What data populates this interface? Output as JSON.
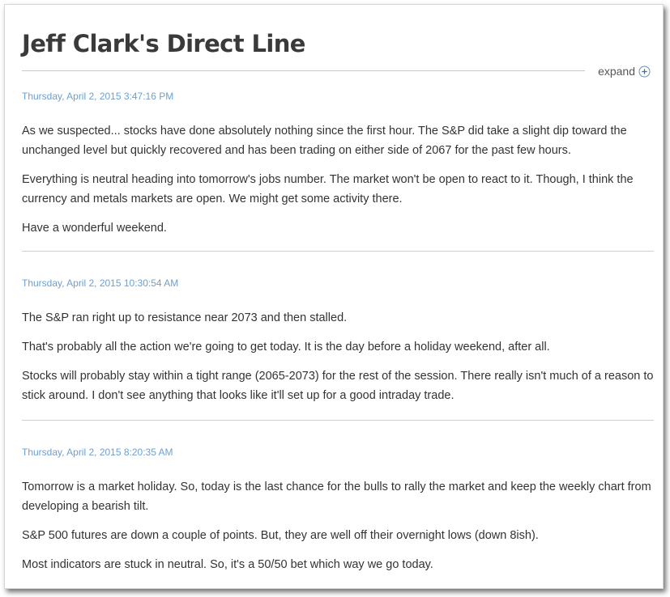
{
  "page": {
    "title": "Jeff Clark's Direct Line",
    "expand_label": "expand",
    "expand_icon": "plus-circle-icon",
    "accent_color": "#6ea0cf"
  },
  "entries": [
    {
      "timestamp": "Thursday, April 2, 2015 3:47:16 PM",
      "paragraphs": [
        "As we suspected... stocks have done absolutely nothing since the first hour. The S&P did take a slight dip toward the unchanged level but quickly recovered and has been trading on either side of 2067 for the past few hours.",
        "Everything is neutral heading into tomorrow's jobs number. The market won't be open to react to it. Though, I think the currency and metals markets are open. We might get some activity there.",
        "Have a wonderful weekend."
      ]
    },
    {
      "timestamp": "Thursday, April 2, 2015 10:30:54 AM",
      "paragraphs": [
        "The S&P ran right up to resistance near 2073 and then stalled.",
        "That's probably all the action we're going to get today. It is the day before a holiday weekend, after all.",
        "Stocks will probably stay within a tight range (2065-2073) for the rest of the session. There really isn't much of a reason to stick around. I don't see anything that looks like it'll set up for a good intraday trade."
      ]
    },
    {
      "timestamp": "Thursday, April 2, 2015 8:20:35 AM",
      "paragraphs": [
        "Tomorrow is a market holiday. So, today is the last chance for the bulls to rally the market and keep the weekly chart from developing a bearish tilt.",
        "S&P 500 futures are down a couple of points. But, they are well off their overnight lows (down 8ish).",
        "Most indicators are stuck in neutral. So, it's a 50/50 bet which way we go today."
      ]
    }
  ]
}
